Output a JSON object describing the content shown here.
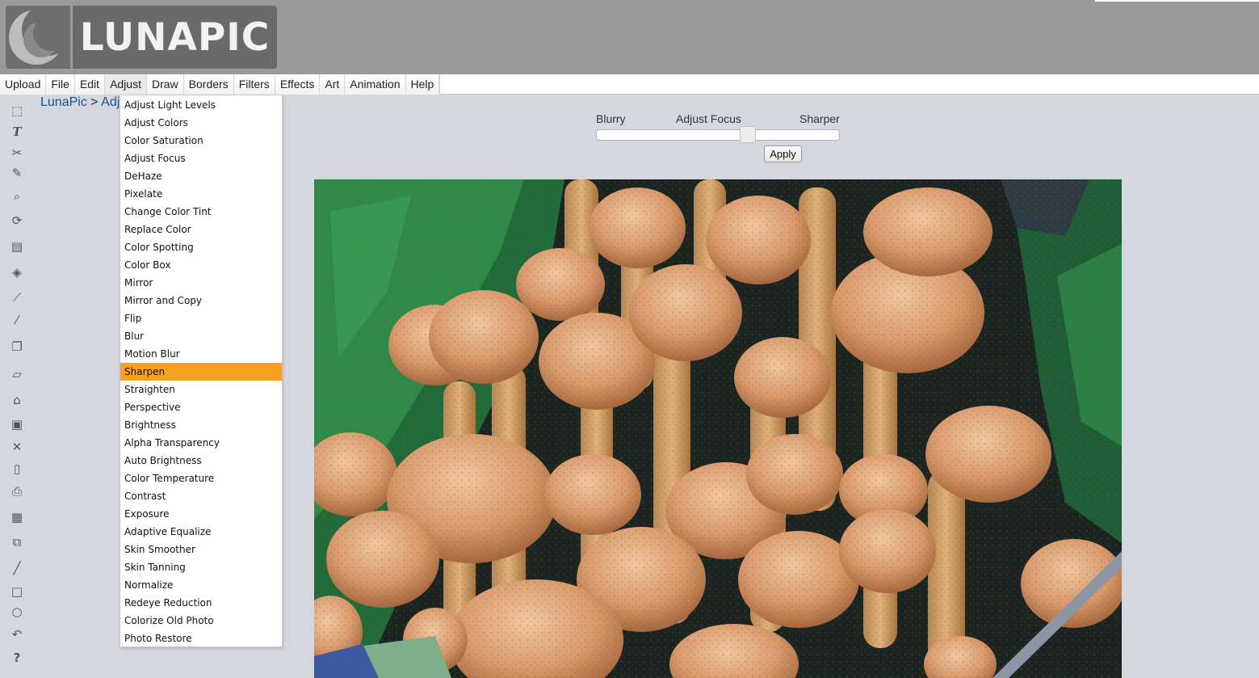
{
  "header": {
    "logo_text": "LUNAPIC",
    "colors": {
      "header_bg": "#9a9a9a",
      "logo_bg": "#6a6a6a",
      "logo_text": "#f2f2f2"
    }
  },
  "menubar": {
    "items": [
      "Upload",
      "File",
      "Edit",
      "Adjust",
      "Draw",
      "Borders",
      "Filters",
      "Effects",
      "Art",
      "Animation",
      "Help"
    ],
    "active": "Adjust"
  },
  "breadcrumb": {
    "home": "LunaPic",
    "separator": ">",
    "current": "Adju"
  },
  "toolbar": {
    "icons": [
      "marquee-select-icon",
      "text-icon",
      "scissors-icon",
      "pencil-icon",
      "magnifier-icon",
      "rotate-icon",
      "canvas-icon",
      "paint-bucket-icon",
      "eyedropper-icon",
      "brush-icon",
      "layers-icon",
      "eraser-icon",
      "open-folder-icon",
      "save-icon",
      "close-icon",
      "new-page-icon",
      "print-icon",
      "paste-icon",
      "copy-icon",
      "line-icon",
      "rectangle-icon",
      "circle-icon",
      "undo-icon",
      "help-icon"
    ]
  },
  "dropdown": {
    "items": [
      "Adjust Light Levels",
      "Adjust Colors",
      "Color Saturation",
      "Adjust Focus",
      "DeHaze",
      "Pixelate",
      "Change Color Tint",
      "Replace Color",
      "Color Spotting",
      "Color Box",
      "Mirror",
      "Mirror and Copy",
      "Flip",
      "Blur",
      "Motion Blur",
      "Sharpen",
      "Straighten",
      "Perspective",
      "Brightness",
      "Alpha Transparency",
      "Auto Brightness",
      "Color Temperature",
      "Contrast",
      "Exposure",
      "Adaptive Equalize",
      "Skin Smoother",
      "Skin Tanning",
      "Normalize",
      "Redeye Reduction",
      "Colorize Old Photo",
      "Photo Restore"
    ],
    "highlighted": "Sharpen",
    "highlight_color": "#f7a021"
  },
  "focus_panel": {
    "left_label": "Blurry",
    "center_label": "Adjust Focus",
    "right_label": "Sharper",
    "slider_value_fraction": 0.63,
    "apply_label": "Apply"
  },
  "canvas": {
    "subject": "photo-mushrooms"
  }
}
